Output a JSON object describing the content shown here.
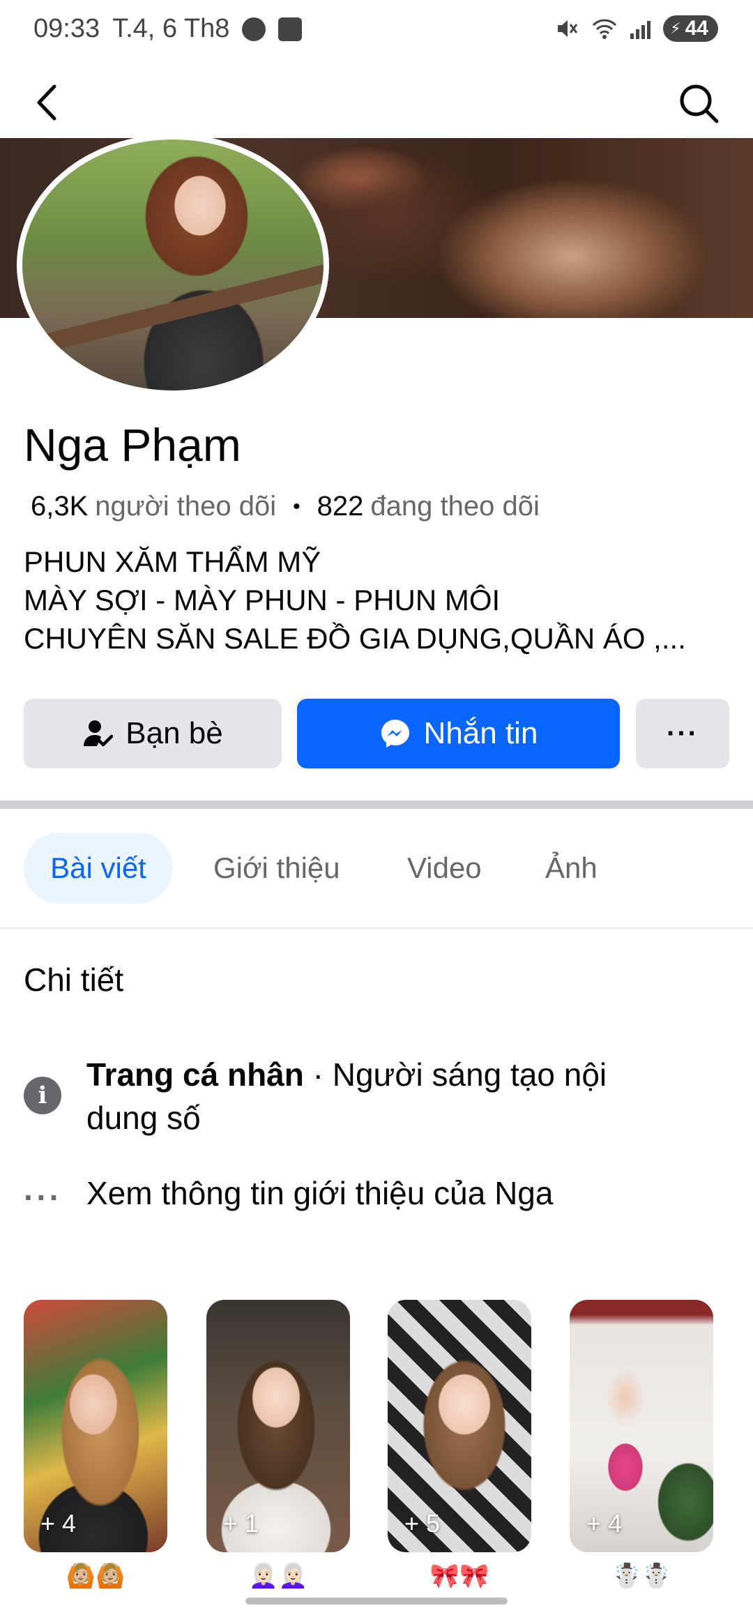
{
  "status_bar": {
    "time": "09:33",
    "date": "T.4, 6 Th8",
    "battery": "44",
    "icons": [
      "messenger-icon",
      "shopee-icon",
      "mute-icon",
      "wifi-icon",
      "signal-icon",
      "battery-icon"
    ]
  },
  "nav": {
    "back_icon": "back-arrow-icon",
    "search_icon": "search-icon"
  },
  "profile": {
    "name": "Nga Phạm",
    "followers_count": "6,3K",
    "followers_label": "người theo dõi",
    "following_count": "822",
    "following_label": "đang theo dõi",
    "bio": [
      "PHUN XĂM THẨM MỸ",
      "MÀY SỢI - MÀY PHUN - PHUN MÔI",
      "CHUYÊN SĂN SALE ĐỒ GIA DỤNG,QUẦN ÁO ,..."
    ]
  },
  "actions": {
    "friends_label": "Bạn bè",
    "message_label": "Nhắn tin",
    "more_label": "···"
  },
  "tabs": [
    {
      "label": "Bài viết",
      "active": true
    },
    {
      "label": "Giới thiệu",
      "active": false
    },
    {
      "label": "Video",
      "active": false
    },
    {
      "label": "Ảnh",
      "active": false
    }
  ],
  "details": {
    "title": "Chi tiết",
    "page_type_strong": "Trang cá nhân",
    "page_type_rest": " · Người sáng tạo nội dung số",
    "see_more": "Xem thông tin giới thiệu của Nga"
  },
  "highlights": [
    {
      "count": "+ 4",
      "caption": "🙆🏼🙆🏼"
    },
    {
      "count": "+ 1",
      "caption": "👩🏻‍🦳👩🏻‍🦳"
    },
    {
      "count": "+ 5",
      "caption": "🎀🎀"
    },
    {
      "count": "+ 4",
      "caption": "☃️☃️"
    }
  ],
  "colors": {
    "primary": "#0866ff",
    "button_gray": "#e4e6eb",
    "secondary_text": "#65676b",
    "active_tab_bg": "#ebf5ff"
  }
}
